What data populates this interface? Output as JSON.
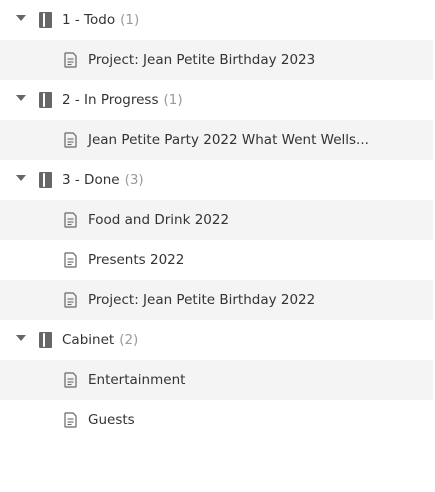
{
  "groups": [
    {
      "name": "1 - Todo",
      "count": "(1)",
      "items": [
        "Project: Jean Petite Birthday 2023"
      ]
    },
    {
      "name": "2 - In Progress",
      "count": "(1)",
      "items": [
        "Jean Petite Party 2022 What Went Wells..."
      ]
    },
    {
      "name": "3 - Done",
      "count": "(3)",
      "items": [
        "Food and Drink 2022",
        "Presents 2022",
        "Project: Jean Petite Birthday 2022"
      ]
    },
    {
      "name": "Cabinet",
      "count": "(2)",
      "items": [
        "Entertainment",
        "Guests"
      ]
    }
  ],
  "colors": {
    "shaded_row": "#f4f4f4",
    "text": "#333333",
    "count": "#9a9a9a",
    "icon": "#666666"
  },
  "icons": {
    "group_toggle": "chevron-down-icon",
    "group": "notebook-icon",
    "item": "document-icon"
  }
}
